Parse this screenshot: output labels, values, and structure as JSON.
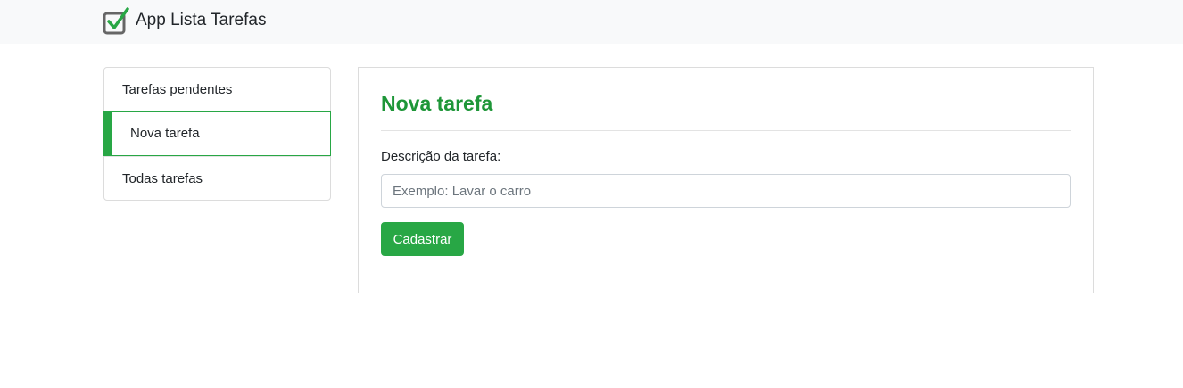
{
  "navbar": {
    "brand_icon": "checkbox-check-icon",
    "brand_text": "App Lista Tarefas"
  },
  "sidebar": {
    "items": [
      {
        "label": "Tarefas pendentes",
        "active": false
      },
      {
        "label": "Nova tarefa",
        "active": true
      },
      {
        "label": "Todas tarefas",
        "active": false
      }
    ]
  },
  "main": {
    "title": "Nova tarefa",
    "field_label": "Descrição da tarefa:",
    "input_placeholder": "Exemplo: Lavar o carro",
    "input_value": "",
    "submit_label": "Cadastrar"
  },
  "colors": {
    "accent": "#28a745",
    "title": "#1e9638",
    "navbar_bg": "#f8f9fa"
  }
}
